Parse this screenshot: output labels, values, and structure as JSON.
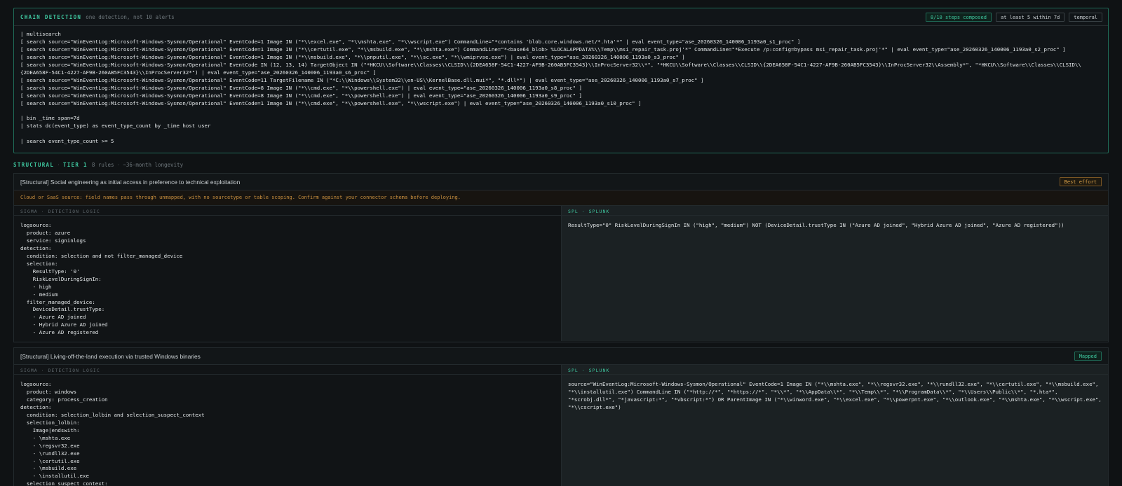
{
  "chain": {
    "title": "CHAIN DETECTION",
    "subtitle": "one detection, not 10 alerts",
    "badges": {
      "steps": "8/10 steps composed",
      "window": "at least 5 within 7d",
      "mode": "temporal"
    },
    "spl": "| multisearch\n[ search source=\"WinEventLog:Microsoft-Windows-Sysmon/Operational\" EventCode=1 Image IN (\"*\\\\excel.exe\", \"*\\\\mshta.exe\", \"*\\\\wscript.exe\") CommandLine=\"*contains 'blob.core.windows.net/*.hta'*\" | eval event_type=\"ase_20260326_140006_1193a0_s1_proc\" ]\n[ search source=\"WinEventLog:Microsoft-Windows-Sysmon/Operational\" EventCode=1 Image IN (\"*\\\\certutil.exe\", \"*\\\\msbuild.exe\", \"*\\\\mshta.exe\") CommandLine=\"*<base64_blob> %LOCALAPPDATA%\\\\Temp\\\\msi_repair_task.proj'*\" CommandLine=\"*Execute /p:config=bypass msi_repair_task.proj'*\" | eval event_type=\"ase_20260326_140006_1193a0_s2_proc\" ]\n[ search source=\"WinEventLog:Microsoft-Windows-Sysmon/Operational\" EventCode=1 Image IN (\"*\\\\msbuild.exe\", \"*\\\\pnputil.exe\", \"*\\\\sc.exe\", \"*\\\\wmiprvse.exe\") | eval event_type=\"ase_20260326_140006_1193a0_s3_proc\" ]\n[ search source=\"WinEventLog:Microsoft-Windows-Sysmon/Operational\" EventCode IN (12, 13, 14) TargetObject IN (\"*HKCU\\\\Software\\\\Classes\\\\CLSID\\\\{2DEA658F-54C1-4227-AF9B-260AB5FC3543}\\\\InProcServer32\\\\*\", \"*HKCU\\\\Software\\\\Classes\\\\CLSID\\\\{2DEA658F-54C1-4227-AF9B-260AB5FC3543}\\\\InProcServer32\\\\Assembly*\", \"*HKCU\\\\Software\\\\Classes\\\\CLSID\\\\{2DEA658F-54C1-4227-AF9B-260AB5FC3543}\\\\InProcServer32*\") | eval event_type=\"ase_20260326_140006_1193a0_s6_proc\" ]\n[ search source=\"WinEventLog:Microsoft-Windows-Sysmon/Operational\" EventCode=11 TargetFilename IN (\"*C:\\\\Windows\\\\System32\\\\en-US\\\\KernelBase.dll.mui*\", \"*.dll*\") | eval event_type=\"ase_20260326_140006_1193a0_s7_proc\" ]\n[ search source=\"WinEventLog:Microsoft-Windows-Sysmon/Operational\" EventCode=8 Image IN (\"*\\\\cmd.exe\", \"*\\\\powershell.exe\") | eval event_type=\"ase_20260326_140006_1193a0_s8_proc\" ]\n[ search source=\"WinEventLog:Microsoft-Windows-Sysmon/Operational\" EventCode=8 Image IN (\"*\\\\cmd.exe\", \"*\\\\powershell.exe\") | eval event_type=\"ase_20260326_140006_1193a0_s9_proc\" ]\n[ search source=\"WinEventLog:Microsoft-Windows-Sysmon/Operational\" EventCode=1 Image IN (\"*\\\\cmd.exe\", \"*\\\\powershell.exe\", \"*\\\\wscript.exe\") | eval event_type=\"ase_20260326_140006_1193a0_s10_proc\" ]\n\n| bin _time span=7d\n| stats dc(event_type) as event_type_count by _time host user\n\n| search event_type_count >= 5"
  },
  "structural": {
    "label": "STRUCTURAL",
    "tier": "TIER 1",
    "rules": "8 rules",
    "longevity": "~36-month longevity"
  },
  "rules": [
    {
      "title": "[Structural] Social engineering as initial access in preference to technical exploitation",
      "badge": "Best effort",
      "warning": "Cloud or SaaS source: field names pass through unmapped, with no sourcetype or table scoping. Confirm against your connector schema before deploying.",
      "sigma_label": "SIGMA · DETECTION LOGIC",
      "spl_label": "SPL · SPLUNK",
      "sigma": "logsource:\n  product: azure\n  service: signinlogs\ndetection:\n  condition: selection and not filter_managed_device\n  selection:\n    ResultType: '0'\n    RiskLevelDuringSignIn:\n    - high\n    - medium\n  filter_managed_device:\n    DeviceDetail.trustType:\n    - Azure AD joined\n    - Hybrid Azure AD joined\n    - Azure AD registered",
      "spl": "ResultType=\"0\" RiskLevelDuringSignIn IN (\"high\", \"medium\") NOT (DeviceDetail.trustType IN (\"Azure AD joined\", \"Hybrid Azure AD joined\", \"Azure AD registered\"))"
    },
    {
      "title": "[Structural] Living-off-the-land execution via trusted Windows binaries",
      "badge": "Mapped",
      "sigma_label": "SIGMA · DETECTION LOGIC",
      "spl_label": "SPL · SPLUNK",
      "sigma": "logsource:\n  product: windows\n  category: process_creation\ndetection:\n  condition: selection_lolbin and selection_suspect_context\n  selection_lolbin:\n    Image|endswith:\n    - \\mshta.exe\n    - \\regsvr32.exe\n    - \\rundll32.exe\n    - \\certutil.exe\n    - \\msbuild.exe\n    - \\installutil.exe\n  selection_suspect_context:",
      "spl": "source=\"WinEventLog:Microsoft-Windows-Sysmon/Operational\" EventCode=1 Image IN (\"*\\\\mshta.exe\", \"*\\\\regsvr32.exe\", \"*\\\\rundll32.exe\", \"*\\\\certutil.exe\", \"*\\\\msbuild.exe\", \"*\\\\installutil.exe\") CommandLine IN (\"*http://*\", \"*https://*\", \"*\\\\*\", \"*\\\\AppData\\\\*\", \"*\\\\Temp\\\\*\", \"*\\\\ProgramData\\\\*\", \"*\\\\Users\\\\Public\\\\*\", \"*.hta*\", \"*scrobj.dll*\", \"*javascript:*\", \"*vbscript:*\") OR ParentImage IN (\"*\\\\winword.exe\", \"*\\\\excel.exe\", \"*\\\\powerpnt.exe\", \"*\\\\outlook.exe\", \"*\\\\mshta.exe\", \"*\\\\wscript.exe\", \"*\\\\cscript.exe\")"
    }
  ]
}
